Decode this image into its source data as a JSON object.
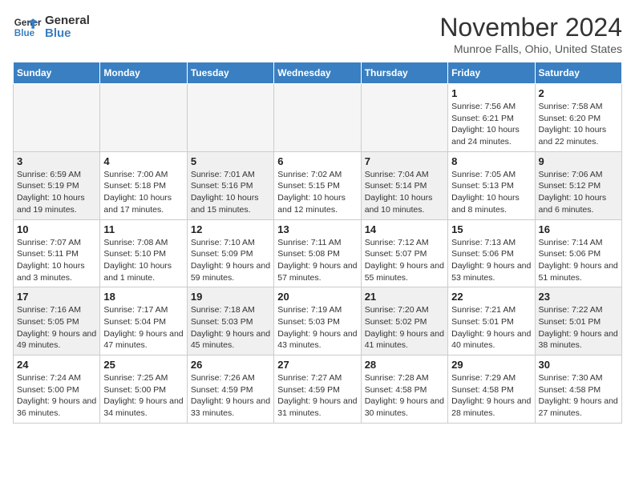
{
  "logo": {
    "line1": "General",
    "line2": "Blue"
  },
  "title": "November 2024",
  "location": "Munroe Falls, Ohio, United States",
  "days_of_week": [
    "Sunday",
    "Monday",
    "Tuesday",
    "Wednesday",
    "Thursday",
    "Friday",
    "Saturday"
  ],
  "weeks": [
    [
      {
        "day": "",
        "info": ""
      },
      {
        "day": "",
        "info": ""
      },
      {
        "day": "",
        "info": ""
      },
      {
        "day": "",
        "info": ""
      },
      {
        "day": "",
        "info": ""
      },
      {
        "day": "1",
        "info": "Sunrise: 7:56 AM\nSunset: 6:21 PM\nDaylight: 10 hours and 24 minutes."
      },
      {
        "day": "2",
        "info": "Sunrise: 7:58 AM\nSunset: 6:20 PM\nDaylight: 10 hours and 22 minutes."
      }
    ],
    [
      {
        "day": "3",
        "info": "Sunrise: 6:59 AM\nSunset: 5:19 PM\nDaylight: 10 hours and 19 minutes."
      },
      {
        "day": "4",
        "info": "Sunrise: 7:00 AM\nSunset: 5:18 PM\nDaylight: 10 hours and 17 minutes."
      },
      {
        "day": "5",
        "info": "Sunrise: 7:01 AM\nSunset: 5:16 PM\nDaylight: 10 hours and 15 minutes."
      },
      {
        "day": "6",
        "info": "Sunrise: 7:02 AM\nSunset: 5:15 PM\nDaylight: 10 hours and 12 minutes."
      },
      {
        "day": "7",
        "info": "Sunrise: 7:04 AM\nSunset: 5:14 PM\nDaylight: 10 hours and 10 minutes."
      },
      {
        "day": "8",
        "info": "Sunrise: 7:05 AM\nSunset: 5:13 PM\nDaylight: 10 hours and 8 minutes."
      },
      {
        "day": "9",
        "info": "Sunrise: 7:06 AM\nSunset: 5:12 PM\nDaylight: 10 hours and 6 minutes."
      }
    ],
    [
      {
        "day": "10",
        "info": "Sunrise: 7:07 AM\nSunset: 5:11 PM\nDaylight: 10 hours and 3 minutes."
      },
      {
        "day": "11",
        "info": "Sunrise: 7:08 AM\nSunset: 5:10 PM\nDaylight: 10 hours and 1 minute."
      },
      {
        "day": "12",
        "info": "Sunrise: 7:10 AM\nSunset: 5:09 PM\nDaylight: 9 hours and 59 minutes."
      },
      {
        "day": "13",
        "info": "Sunrise: 7:11 AM\nSunset: 5:08 PM\nDaylight: 9 hours and 57 minutes."
      },
      {
        "day": "14",
        "info": "Sunrise: 7:12 AM\nSunset: 5:07 PM\nDaylight: 9 hours and 55 minutes."
      },
      {
        "day": "15",
        "info": "Sunrise: 7:13 AM\nSunset: 5:06 PM\nDaylight: 9 hours and 53 minutes."
      },
      {
        "day": "16",
        "info": "Sunrise: 7:14 AM\nSunset: 5:06 PM\nDaylight: 9 hours and 51 minutes."
      }
    ],
    [
      {
        "day": "17",
        "info": "Sunrise: 7:16 AM\nSunset: 5:05 PM\nDaylight: 9 hours and 49 minutes."
      },
      {
        "day": "18",
        "info": "Sunrise: 7:17 AM\nSunset: 5:04 PM\nDaylight: 9 hours and 47 minutes."
      },
      {
        "day": "19",
        "info": "Sunrise: 7:18 AM\nSunset: 5:03 PM\nDaylight: 9 hours and 45 minutes."
      },
      {
        "day": "20",
        "info": "Sunrise: 7:19 AM\nSunset: 5:03 PM\nDaylight: 9 hours and 43 minutes."
      },
      {
        "day": "21",
        "info": "Sunrise: 7:20 AM\nSunset: 5:02 PM\nDaylight: 9 hours and 41 minutes."
      },
      {
        "day": "22",
        "info": "Sunrise: 7:21 AM\nSunset: 5:01 PM\nDaylight: 9 hours and 40 minutes."
      },
      {
        "day": "23",
        "info": "Sunrise: 7:22 AM\nSunset: 5:01 PM\nDaylight: 9 hours and 38 minutes."
      }
    ],
    [
      {
        "day": "24",
        "info": "Sunrise: 7:24 AM\nSunset: 5:00 PM\nDaylight: 9 hours and 36 minutes."
      },
      {
        "day": "25",
        "info": "Sunrise: 7:25 AM\nSunset: 5:00 PM\nDaylight: 9 hours and 34 minutes."
      },
      {
        "day": "26",
        "info": "Sunrise: 7:26 AM\nSunset: 4:59 PM\nDaylight: 9 hours and 33 minutes."
      },
      {
        "day": "27",
        "info": "Sunrise: 7:27 AM\nSunset: 4:59 PM\nDaylight: 9 hours and 31 minutes."
      },
      {
        "day": "28",
        "info": "Sunrise: 7:28 AM\nSunset: 4:58 PM\nDaylight: 9 hours and 30 minutes."
      },
      {
        "day": "29",
        "info": "Sunrise: 7:29 AM\nSunset: 4:58 PM\nDaylight: 9 hours and 28 minutes."
      },
      {
        "day": "30",
        "info": "Sunrise: 7:30 AM\nSunset: 4:58 PM\nDaylight: 9 hours and 27 minutes."
      }
    ]
  ]
}
